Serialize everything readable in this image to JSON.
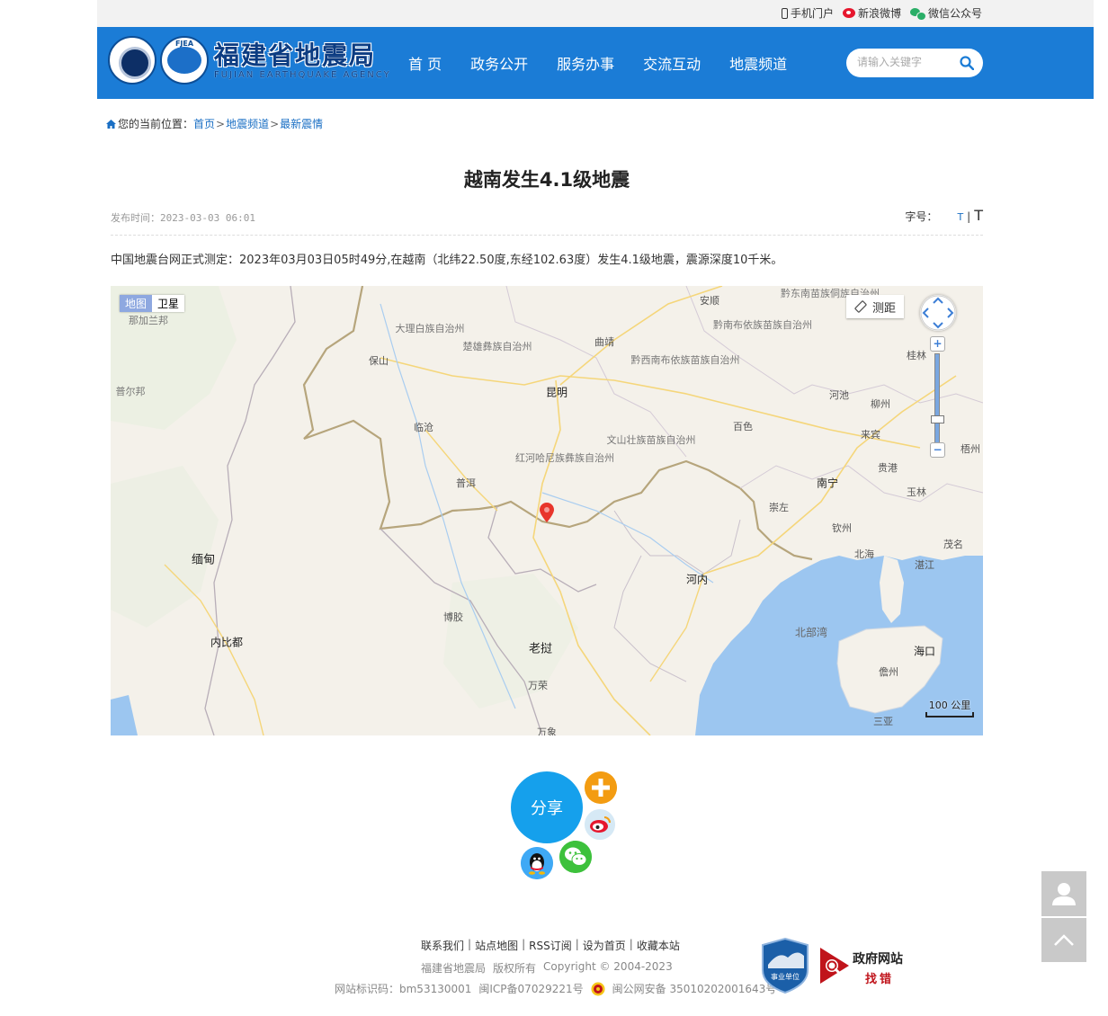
{
  "top_links": {
    "mobile": "手机门户",
    "weibo": "新浪微博",
    "wechat": "微信公众号"
  },
  "logo": {
    "name_cn": "福建省地震局",
    "name_en": "FUJIAN EARTHQUAKE AGENCY",
    "badge": "FJEA"
  },
  "nav": [
    "首 页",
    "政务公开",
    "服务办事",
    "交流互动",
    "地震频道"
  ],
  "search": {
    "placeholder": "请输入关键字"
  },
  "breadcrumb": {
    "prefix": "您的当前位置：",
    "items": [
      "首页",
      "地震频道",
      "最新震情"
    ],
    "separator": ">"
  },
  "article": {
    "title": "越南发生4.1级地震",
    "published": "发布时间：2023-03-03 06:01",
    "font_size_label": "字号：",
    "font_small": "T",
    "font_sep": "|",
    "font_large": "T",
    "body": "中国地震台网正式测定：2023年03月03日05时49分,在越南（北纬22.50度,东经102.63度）发生4.1级地震，震源深度10千米。"
  },
  "map": {
    "type_buttons": [
      "地图",
      "卫星"
    ],
    "active_type": "地图",
    "measure_label": "测距",
    "zoom_in": "+",
    "zoom_out": "−",
    "scale_label": "100 公里",
    "labels": {
      "l1": "那加兰邦",
      "l2": "普尔邦",
      "l3": "缅甸",
      "l4": "内比都",
      "l5": "大理白族自治州",
      "l6": "保山",
      "l7": "楚雄彝族自治州",
      "l8": "昆明",
      "l9": "曲靖",
      "l10": "临沧",
      "l11": "普洱",
      "l12": "红河哈尼族彝族自治州",
      "l13": "文山壮族苗族自治州",
      "l14": "黔西南布依族苗族自治州",
      "l15": "黔南布依族苗族自治州",
      "l16": "黔东南苗族侗族自治州",
      "l17": "安顺",
      "l18": "百色",
      "l19": "河池",
      "l20": "柳州",
      "l21": "桂林",
      "l22": "来宾",
      "l23": "贵港",
      "l24": "梧州",
      "l25": "南宁",
      "l26": "玉林",
      "l27": "崇左",
      "l28": "钦州",
      "l29": "北海",
      "l30": "茂名",
      "l31": "湛江",
      "l32": "河内",
      "l33": "北部湾",
      "l34": "海口",
      "l35": "儋州",
      "l36": "三亚",
      "l37": "博胶",
      "l38": "老挝",
      "l39": "万荣",
      "l40": "万象"
    }
  },
  "share": {
    "label": "分享"
  },
  "footer": {
    "links": [
      "联系我们",
      "站点地图",
      "RSS订阅",
      "设为首页",
      "收藏本站"
    ],
    "owner": "福建省地震局",
    "rights": "版权所有",
    "copyright": "Copyright © 2004-2023",
    "site_id": "网站标识码：bm53130001",
    "icp": "闽ICP备07029221号",
    "police": "闽公网安备 35010202001643号",
    "badge_unit": "事业单位",
    "gov_fix_1": "政府网站",
    "gov_fix_2": "找错"
  },
  "colors": {
    "header_blue": "#1b7cd6",
    "link_blue": "#1a6fc4",
    "share_blue": "#15a0ec",
    "sea": "#9cc6f0"
  }
}
